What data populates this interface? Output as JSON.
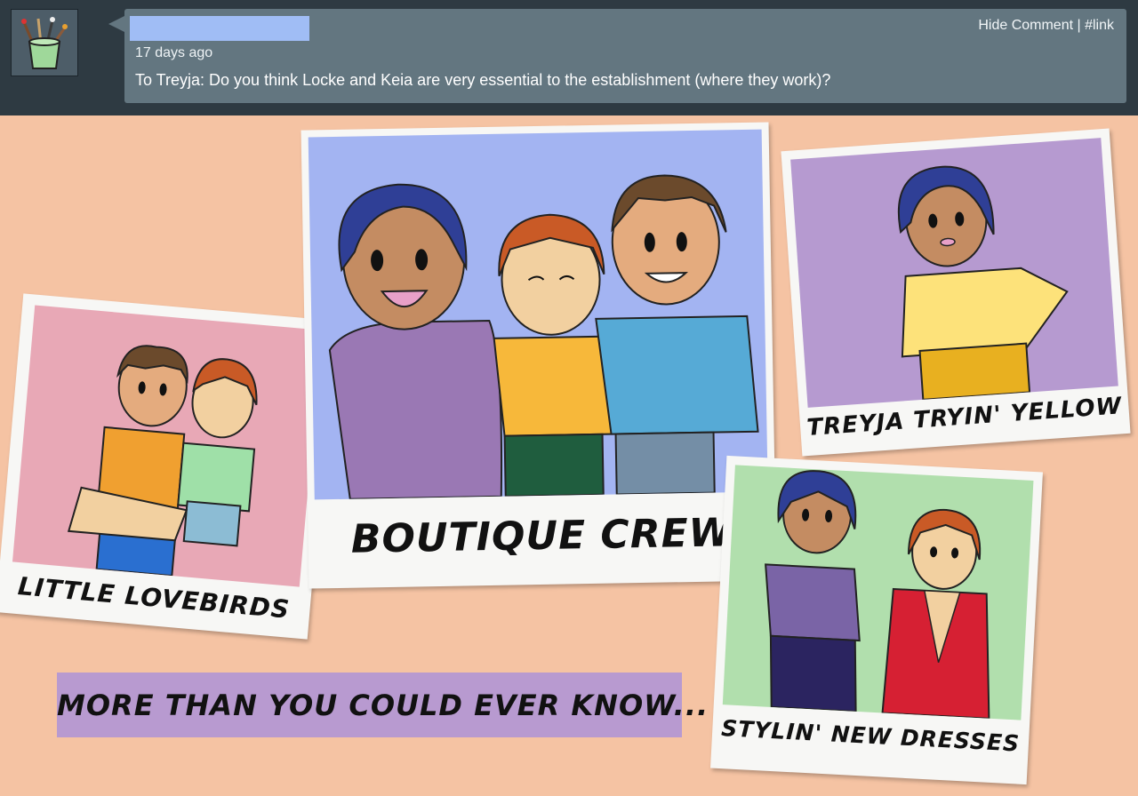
{
  "comment": {
    "timestamp": "17 days ago",
    "text": "To Treyja: Do you think Locke and Keia are very essential to the establishment (where they work)?",
    "hide_label": "Hide Comment",
    "separator": " | ",
    "link_label": "#link",
    "avatar_icon": "paintbrush-cup-icon"
  },
  "photos": {
    "lovebirds_caption": "LITTLE LOVEBIRDS",
    "crew_caption": "BOUTIQUE CREW",
    "treyja_caption": "TREYJA TRYIN' YELLOW",
    "dresses_caption": "STYLIN' NEW DRESSES"
  },
  "banner": {
    "text": "MORE THAN YOU COULD EVER KNOW..."
  },
  "colors": {
    "background": "#f5c3a3",
    "header": "#2e3a42",
    "comment_bubble": "#637680",
    "banner": "#b89ad0"
  }
}
